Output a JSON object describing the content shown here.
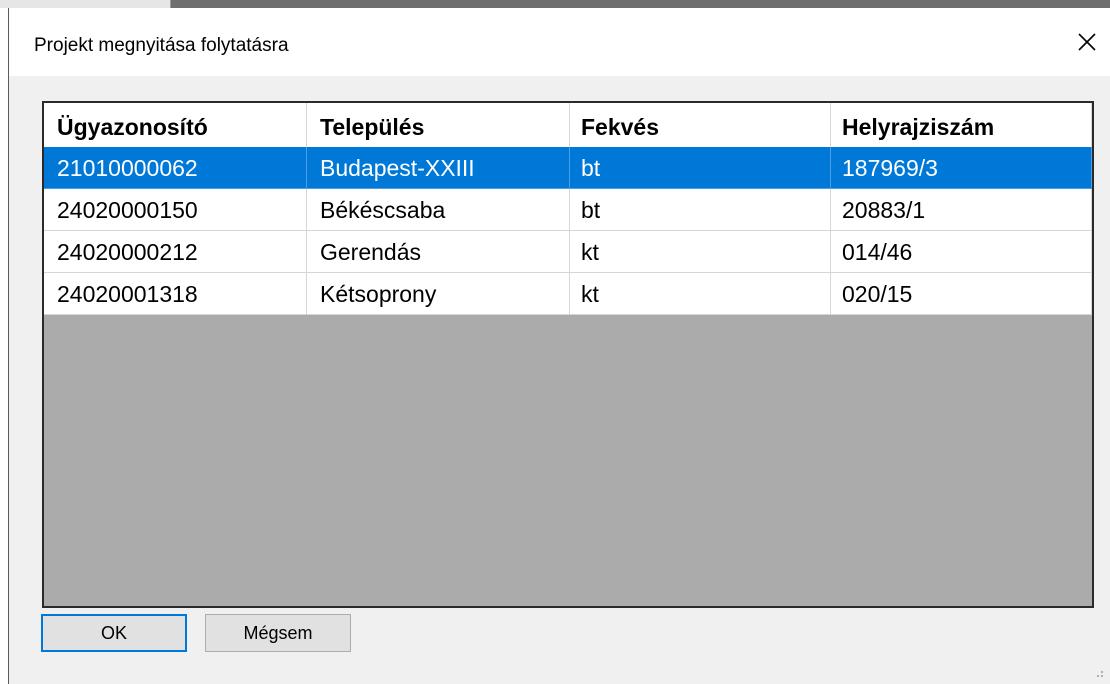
{
  "dialog": {
    "title": "Projekt megnyitása folytatásra",
    "close_icon": "close-icon"
  },
  "table": {
    "columns": [
      "Ügyazonosító",
      "Település",
      "Fekvés",
      "Helyrajziszám"
    ],
    "rows": [
      {
        "id": "21010000062",
        "town": "Budapest-XXIII",
        "fekves": "bt",
        "hrsz": "187969/3",
        "selected": true
      },
      {
        "id": "24020000150",
        "town": "Békéscsaba",
        "fekves": "bt",
        "hrsz": "20883/1",
        "selected": false
      },
      {
        "id": "24020000212",
        "town": "Gerendás",
        "fekves": "kt",
        "hrsz": "014/46",
        "selected": false
      },
      {
        "id": "24020001318",
        "town": "Kétsoprony",
        "fekves": "kt",
        "hrsz": "020/15",
        "selected": false
      }
    ]
  },
  "buttons": {
    "ok_label": "OK",
    "cancel_label": "Mégsem"
  },
  "colors": {
    "selection": "#0078d7",
    "list_background": "#ababab"
  }
}
